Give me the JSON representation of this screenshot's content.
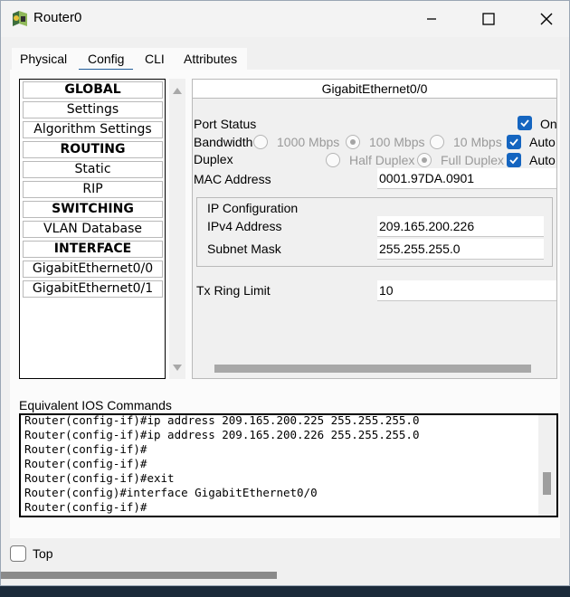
{
  "window": {
    "title": "Router0"
  },
  "tabs": [
    {
      "label": "Physical"
    },
    {
      "label": "Config"
    },
    {
      "label": "CLI"
    },
    {
      "label": "Attributes"
    }
  ],
  "active_tab": "Config",
  "sidebar": {
    "items": [
      {
        "label": "GLOBAL",
        "type": "header"
      },
      {
        "label": "Settings",
        "type": "item"
      },
      {
        "label": "Algorithm Settings",
        "type": "item"
      },
      {
        "label": "ROUTING",
        "type": "header"
      },
      {
        "label": "Static",
        "type": "item"
      },
      {
        "label": "RIP",
        "type": "item"
      },
      {
        "label": "SWITCHING",
        "type": "header"
      },
      {
        "label": "VLAN Database",
        "type": "item"
      },
      {
        "label": "INTERFACE",
        "type": "header"
      },
      {
        "label": "GigabitEthernet0/0",
        "type": "item"
      },
      {
        "label": "GigabitEthernet0/1",
        "type": "item"
      }
    ]
  },
  "interface": {
    "title": "GigabitEthernet0/0",
    "port_status": {
      "label": "Port Status",
      "on_label": "On",
      "checked": true
    },
    "bandwidth": {
      "label": "Bandwidth",
      "options": [
        "1000 Mbps",
        "100 Mbps",
        "10 Mbps"
      ],
      "selected": "100 Mbps",
      "auto_label": "Auto",
      "auto_checked": true
    },
    "duplex": {
      "label": "Duplex",
      "options": [
        "Half Duplex",
        "Full Duplex"
      ],
      "selected": "Full Duplex",
      "auto_label": "Auto",
      "auto_checked": true
    },
    "mac": {
      "label": "MAC Address",
      "value": "0001.97DA.0901"
    },
    "ip_config": {
      "title": "IP Configuration",
      "ipv4_label": "IPv4 Address",
      "ipv4_value": "209.165.200.226",
      "mask_label": "Subnet Mask",
      "mask_value": "255.255.255.0"
    },
    "tx_ring": {
      "label": "Tx Ring Limit",
      "value": "10"
    }
  },
  "ios": {
    "label": "Equivalent IOS Commands",
    "lines": [
      "Router(config-if)#ip address 209.165.200.225 255.255.255.0",
      "Router(config-if)#ip address 209.165.200.226 255.255.255.0",
      "Router(config-if)#",
      "Router(config-if)#",
      "Router(config-if)#exit",
      "Router(config)#interface GigabitEthernet0/0",
      "Router(config-if)#"
    ]
  },
  "footer": {
    "top_label": "Top",
    "top_checked": false
  },
  "colors": {
    "accent": "#1565c0",
    "tab_underline": "#1f5c99"
  }
}
